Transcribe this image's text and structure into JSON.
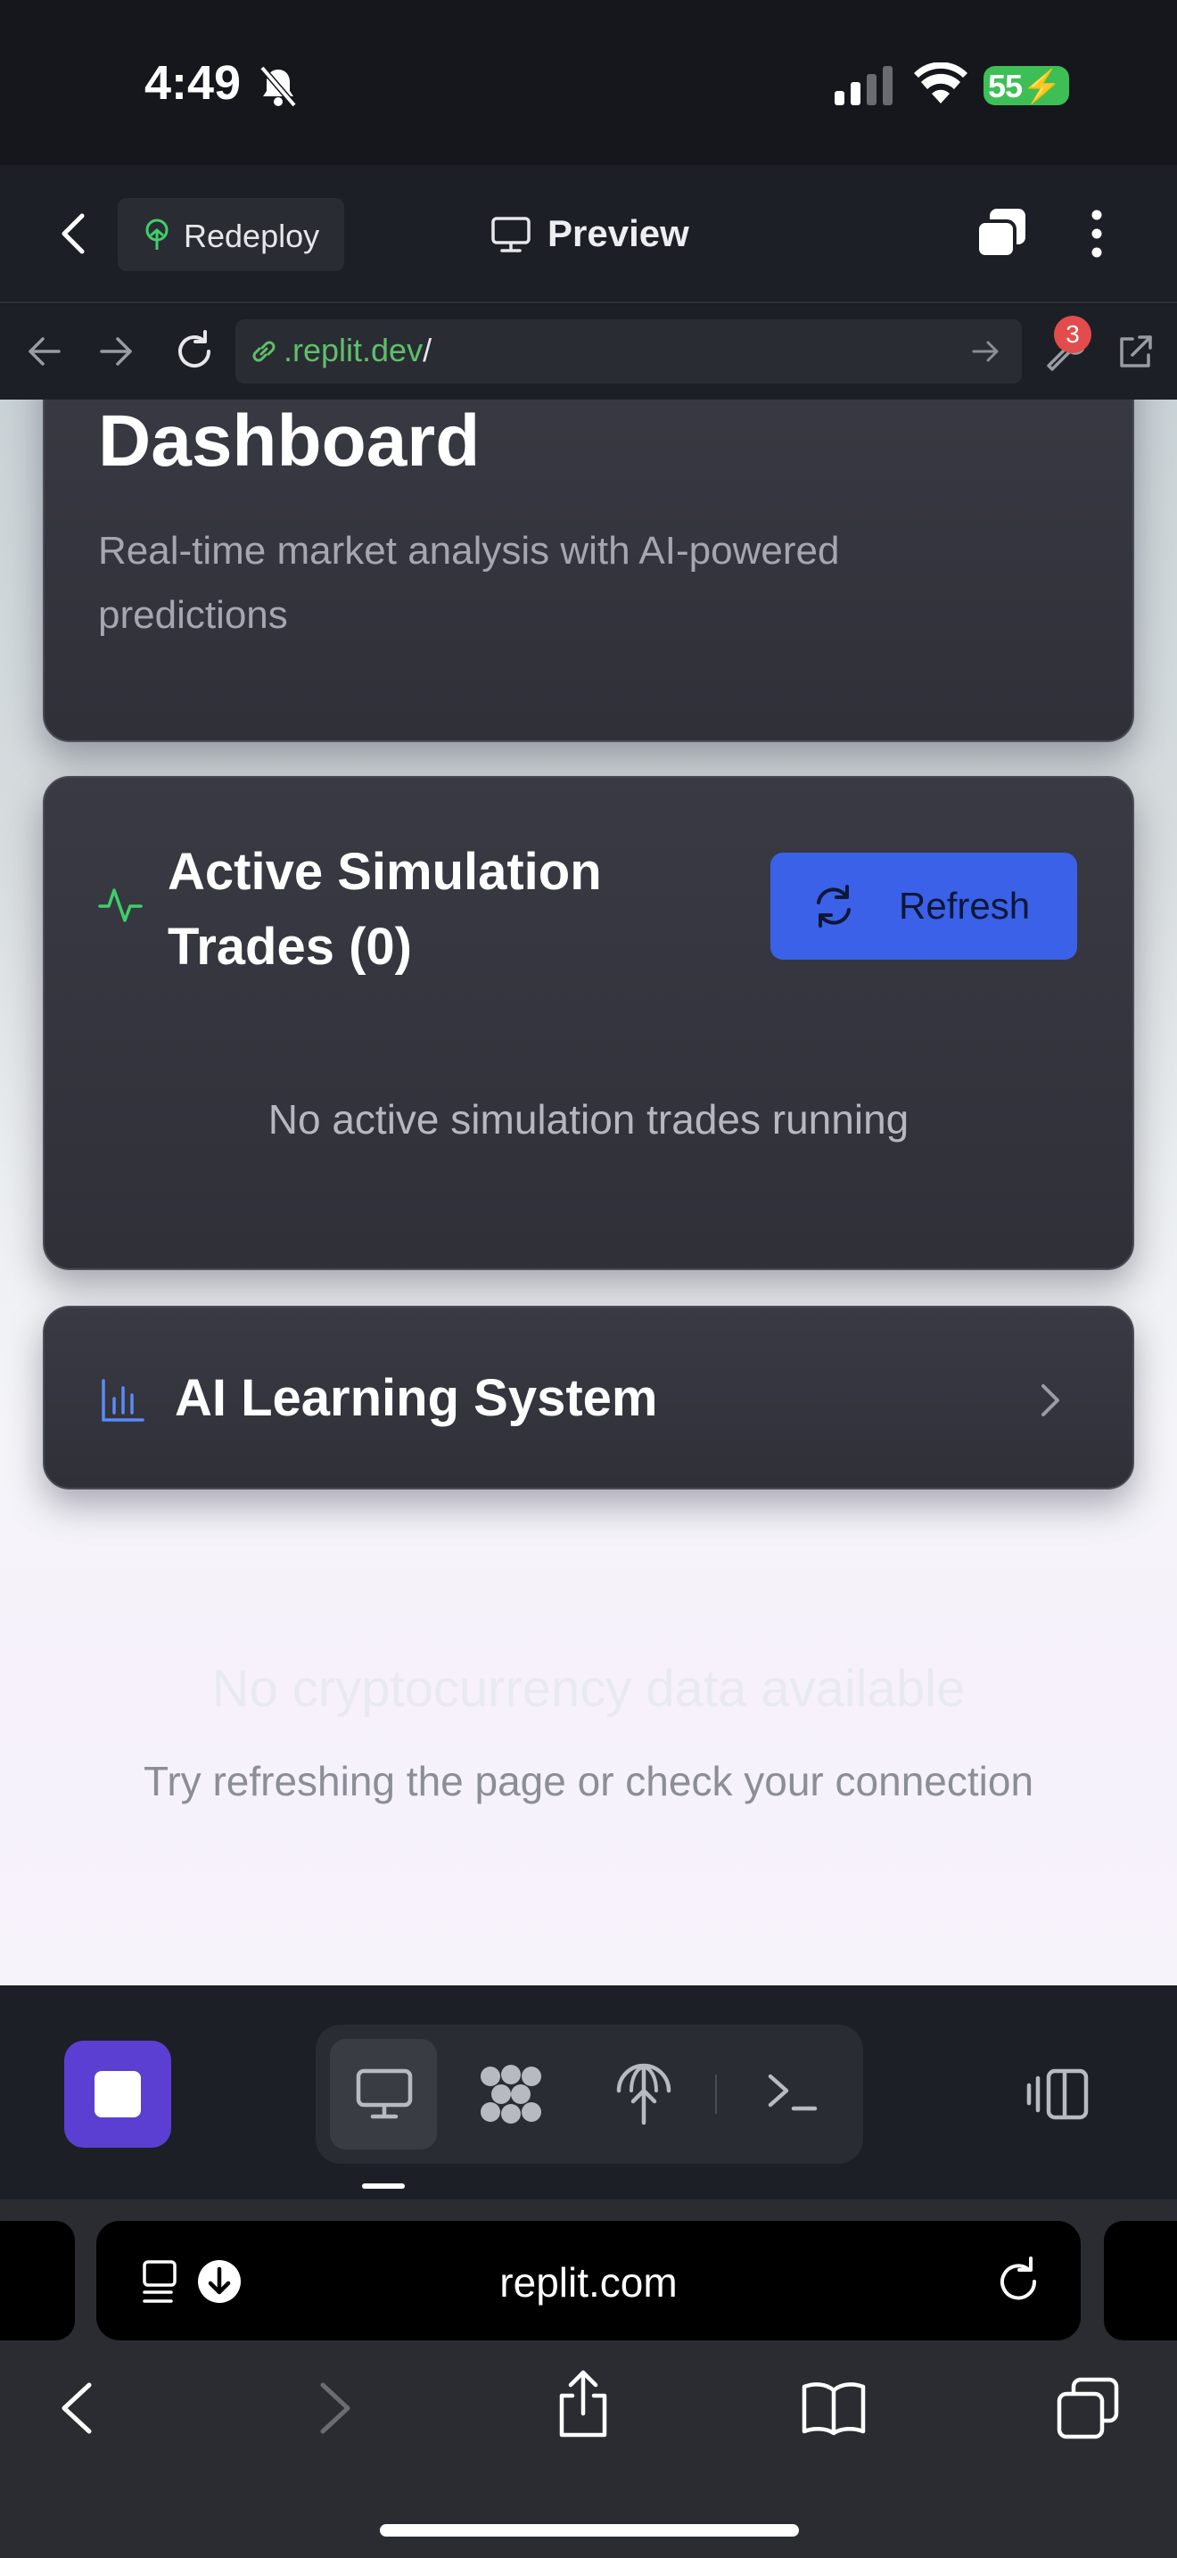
{
  "status_bar": {
    "time": "4:49",
    "battery": "55"
  },
  "replit_header": {
    "redeploy_label": "Redeploy",
    "preview_label": "Preview"
  },
  "address_bar": {
    "url_host": ".replit.dev",
    "url_path": "/",
    "devtools_badge": "3"
  },
  "dashboard": {
    "title": "Dashboard",
    "subtitle": "Real-time market analysis with AI-powered predictions"
  },
  "simulation_card": {
    "title": "Active Simulation Trades (0)",
    "refresh_label": "Refresh",
    "empty_message": "No active simulation trades running"
  },
  "ai_card": {
    "title": "AI Learning System"
  },
  "empty_state": {
    "faded_title": "No cryptocurrency data available",
    "hint": "Try refreshing the page or check your connection"
  },
  "safari": {
    "url": "replit.com"
  },
  "colors": {
    "accent_blue": "#3a61e8",
    "stop_purple": "#5b3fd3",
    "url_green": "#5fbf6a",
    "badge_red": "#e24c4c",
    "battery_green": "#3dbf55",
    "pulse_green": "#3ecf6a",
    "chart_blue": "#5d8af5"
  },
  "icons": [
    "bell-slash-icon",
    "signal-icon",
    "wifi-icon",
    "battery-icon",
    "back-chevron-icon",
    "redeploy-icon",
    "monitor-icon",
    "tabs-icon",
    "more-icon",
    "arrow-left-icon",
    "arrow-right-icon",
    "reload-icon",
    "link-icon",
    "arrow-go-icon",
    "devtools-icon",
    "open-external-icon",
    "pulse-icon",
    "refresh-icon",
    "bar-chart-icon",
    "chevron-right-icon",
    "stop-icon",
    "agent-icon",
    "deploy-icon",
    "shell-icon",
    "layout-icon",
    "reader-icon",
    "download-icon",
    "share-icon",
    "bookmarks-icon",
    "tabs-overview-icon"
  ]
}
